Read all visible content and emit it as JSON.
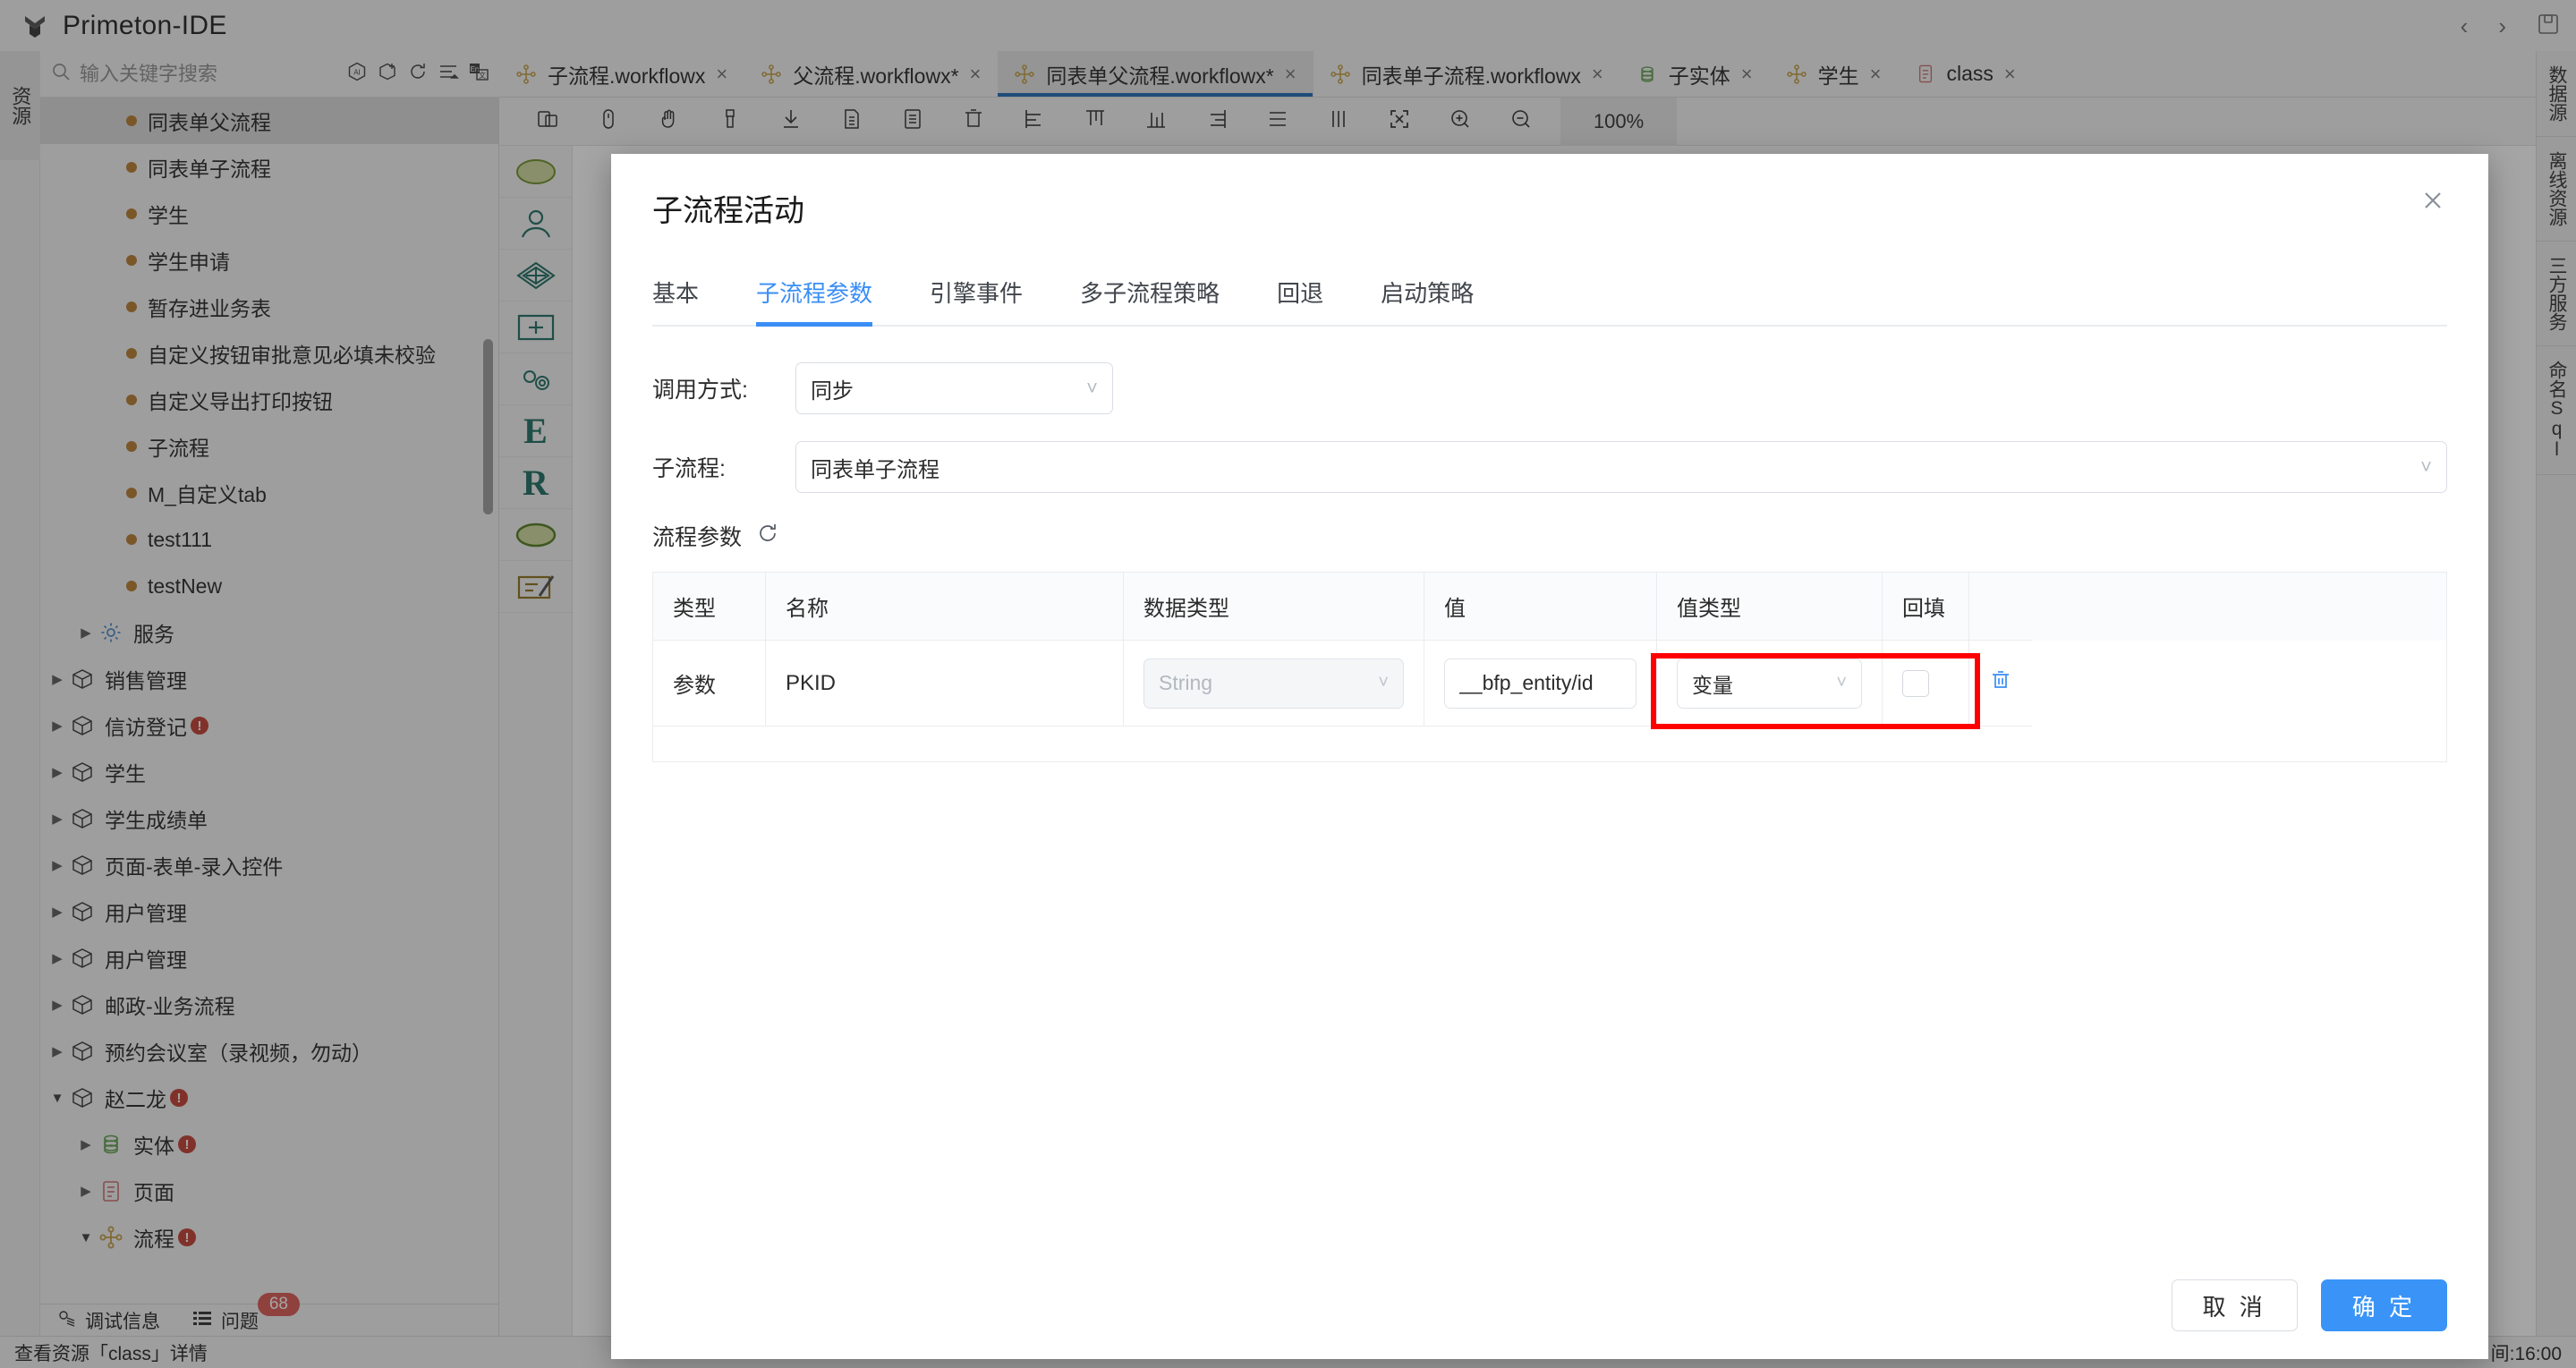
{
  "app": {
    "title": "Primeton-IDE",
    "logo_icon": "primeton-logo-icon",
    "window_back_icon": "chevron-left-icon",
    "window_forward_icon": "chevron-right-icon",
    "window_save_icon": "save-icon"
  },
  "left_rail": {
    "label": "资源"
  },
  "right_rail": {
    "items": [
      {
        "label": "数据源"
      },
      {
        "label": "离线资源"
      },
      {
        "label": "三方服务"
      },
      {
        "label": "命名Sql"
      }
    ]
  },
  "search": {
    "placeholder": "输入关键字搜索",
    "value": "",
    "icons": [
      "search-icon",
      "ai-assistant-icon",
      "add-package-icon",
      "refresh-icon",
      "collapse-all-icon",
      "translate-icon"
    ]
  },
  "tree": {
    "items": [
      {
        "label": "同表单父流程",
        "kind": "dot",
        "indent": 3,
        "selected": true
      },
      {
        "label": "同表单子流程",
        "kind": "dot",
        "indent": 3
      },
      {
        "label": "学生",
        "kind": "dot",
        "indent": 3
      },
      {
        "label": "学生申请",
        "kind": "dot",
        "indent": 3
      },
      {
        "label": "暂存进业务表",
        "kind": "dot",
        "indent": 3
      },
      {
        "label": "自定义按钮审批意见必填未校验",
        "kind": "dot",
        "indent": 3
      },
      {
        "label": "自定义导出打印按钮",
        "kind": "dot",
        "indent": 3
      },
      {
        "label": "子流程",
        "kind": "dot",
        "indent": 3
      },
      {
        "label": "M_自定义tab",
        "kind": "dot",
        "indent": 3
      },
      {
        "label": "test111",
        "kind": "dot",
        "indent": 3
      },
      {
        "label": "testNew",
        "kind": "dot",
        "indent": 3
      },
      {
        "label": "服务",
        "kind": "gear",
        "indent": 2,
        "twisty": "collapsed"
      },
      {
        "label": "销售管理",
        "kind": "package",
        "indent": 1,
        "twisty": "collapsed"
      },
      {
        "label": "信访登记",
        "kind": "package",
        "indent": 1,
        "twisty": "collapsed",
        "error": true
      },
      {
        "label": "学生",
        "kind": "package",
        "indent": 1,
        "twisty": "collapsed"
      },
      {
        "label": "学生成绩单",
        "kind": "package",
        "indent": 1,
        "twisty": "collapsed"
      },
      {
        "label": "页面-表单-录入控件",
        "kind": "package",
        "indent": 1,
        "twisty": "collapsed"
      },
      {
        "label": "用户管理",
        "kind": "package",
        "indent": 1,
        "twisty": "collapsed"
      },
      {
        "label": "用户管理",
        "kind": "package",
        "indent": 1,
        "twisty": "collapsed"
      },
      {
        "label": "邮政-业务流程",
        "kind": "package",
        "indent": 1,
        "twisty": "collapsed"
      },
      {
        "label": "预约会议室（录视频，勿动）",
        "kind": "package",
        "indent": 1,
        "twisty": "collapsed"
      },
      {
        "label": "赵二龙",
        "kind": "package",
        "indent": 1,
        "twisty": "expanded",
        "error": true
      },
      {
        "label": "实体",
        "kind": "entity",
        "indent": 2,
        "twisty": "collapsed",
        "error": true
      },
      {
        "label": "页面",
        "kind": "page",
        "indent": 2,
        "twisty": "collapsed"
      },
      {
        "label": "流程",
        "kind": "flow",
        "indent": 2,
        "twisty": "expanded",
        "error": true
      }
    ]
  },
  "bottom_tabs": {
    "debug": {
      "label": "调试信息",
      "icon": "debug-icon"
    },
    "problems": {
      "label": "问题",
      "icon": "list-icon",
      "count": "68"
    }
  },
  "statusbar": {
    "left": "查看资源「class」详情",
    "right": "间:16:00"
  },
  "editor_tabs": [
    {
      "label": "子流程.workflowx",
      "icon": "workflow-icon",
      "active": false,
      "close": "×"
    },
    {
      "label": "父流程.workflowx*",
      "icon": "workflow-icon",
      "active": false,
      "close": "×"
    },
    {
      "label": "同表单父流程.workflowx*",
      "icon": "workflow-icon",
      "active": true,
      "close": "×"
    },
    {
      "label": "同表单子流程.workflowx",
      "icon": "workflow-icon",
      "active": false,
      "close": "×"
    },
    {
      "label": "子实体",
      "icon": "entity-icon",
      "active": false,
      "close": "×"
    },
    {
      "label": "学生",
      "icon": "workflow-icon",
      "active": false,
      "close": "×"
    },
    {
      "label": "class",
      "icon": "page-icon",
      "active": false,
      "close": "×"
    }
  ],
  "editor_toolbar": {
    "icons": [
      "select-icon",
      "pointer-icon",
      "pan-hand-icon",
      "format-brush-icon",
      "download-icon",
      "copy-page-icon",
      "paste-page-icon",
      "delete-icon",
      "align-left-icon",
      "align-top-icon",
      "align-bottom-icon",
      "align-right-icon",
      "distribute-vertical-icon",
      "distribute-horizontal-icon",
      "fit-screen-icon",
      "zoom-in-icon",
      "zoom-out-icon"
    ],
    "zoom_level": "100%"
  },
  "palette": {
    "items": [
      "start-node-icon",
      "manual-activity-icon",
      "decision-icon",
      "add-node-icon",
      "auto-activity-icon",
      "e-node-icon",
      "r-node-icon",
      "end-node-icon",
      "sign-activity-icon"
    ]
  },
  "modal": {
    "title": "子流程活动",
    "close_icon": "close-icon",
    "tabs": [
      {
        "label": "基本",
        "active": false
      },
      {
        "label": "子流程参数",
        "active": true
      },
      {
        "label": "引擎事件",
        "active": false
      },
      {
        "label": "多子流程策略",
        "active": false
      },
      {
        "label": "回退",
        "active": false
      },
      {
        "label": "启动策略",
        "active": false
      }
    ],
    "fields": {
      "call_mode_label": "调用方式:",
      "call_mode_value": "同步",
      "subflow_label": "子流程:",
      "subflow_value": "同表单子流程"
    },
    "params_section": {
      "title": "流程参数",
      "refresh_icon": "refresh-icon"
    },
    "table": {
      "headers": [
        "类型",
        "名称",
        "数据类型",
        "值",
        "值类型",
        "回填",
        ""
      ],
      "rows": [
        {
          "type": "参数",
          "name": "PKID",
          "data_type": "String",
          "value": "__bfp_entity/id",
          "value_type": "变量",
          "backfill_checked": false,
          "delete_icon": "trash-icon"
        }
      ]
    },
    "footer": {
      "cancel": "取 消",
      "confirm": "确 定"
    },
    "accent_color": "#3a8ef6",
    "highlight_color": "#ff0000"
  }
}
